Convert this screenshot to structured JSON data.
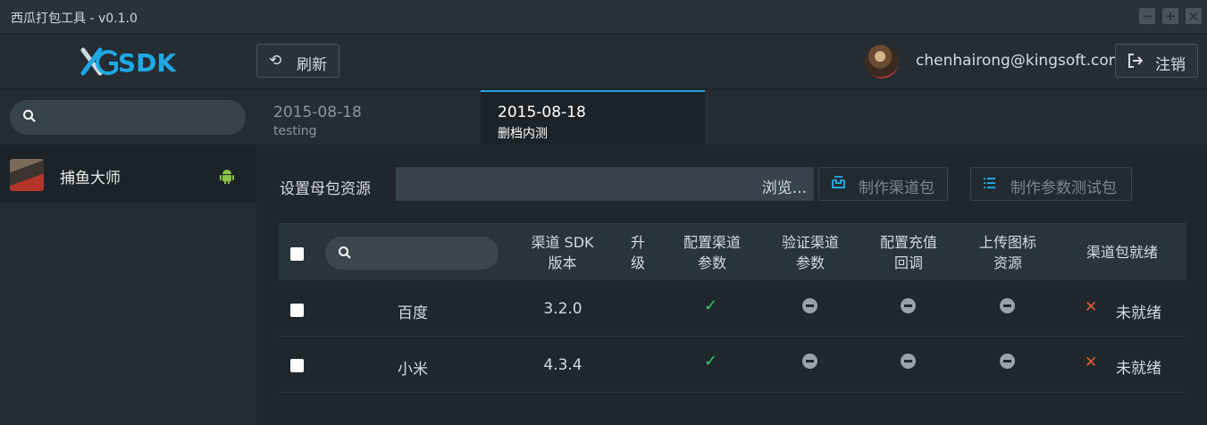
{
  "window": {
    "title": "西瓜打包工具 - v0.1.0"
  },
  "header": {
    "logo_text": "SDK",
    "refresh_label": "刷新",
    "user_email": "chenhairong@kingsoft.com",
    "logout_label": "注销"
  },
  "sidebar": {
    "search_placeholder": "",
    "games": [
      {
        "name": "捕鱼大师",
        "platform": "android-icon"
      }
    ]
  },
  "tabs": [
    {
      "date": "2015-08-18",
      "subtitle": "testing",
      "active": false
    },
    {
      "date": "2015-08-18",
      "subtitle": "删档内测",
      "active": true
    }
  ],
  "main": {
    "set_source_label": "设置母包资源",
    "path_value": "",
    "browse_label": "浏览...",
    "make_channel_label": "制作渠道包",
    "make_param_test_label": "制作参数测试包"
  },
  "table": {
    "headers": {
      "sdk_version": [
        "渠道 SDK",
        "版本"
      ],
      "upgrade": [
        "升",
        "级"
      ],
      "config_params": [
        "配置渠道",
        "参数"
      ],
      "verify_params": [
        "验证渠道",
        "参数"
      ],
      "config_callback": [
        "配置充值",
        "回调"
      ],
      "upload_icon": [
        "上传图标",
        "资源"
      ],
      "ready": "渠道包就绪"
    },
    "rows": [
      {
        "name": "百度",
        "version": "3.2.0",
        "config": "check",
        "verify": "none",
        "callback": "none",
        "icon": "none",
        "ready_status": "未就绪"
      },
      {
        "name": "小米",
        "version": "4.3.4",
        "config": "check",
        "verify": "none",
        "callback": "none",
        "icon": "none",
        "ready_status": "未就绪"
      }
    ]
  },
  "colors": {
    "accent": "#22a4dd",
    "check": "#2ecc71",
    "error": "#e25b34"
  }
}
